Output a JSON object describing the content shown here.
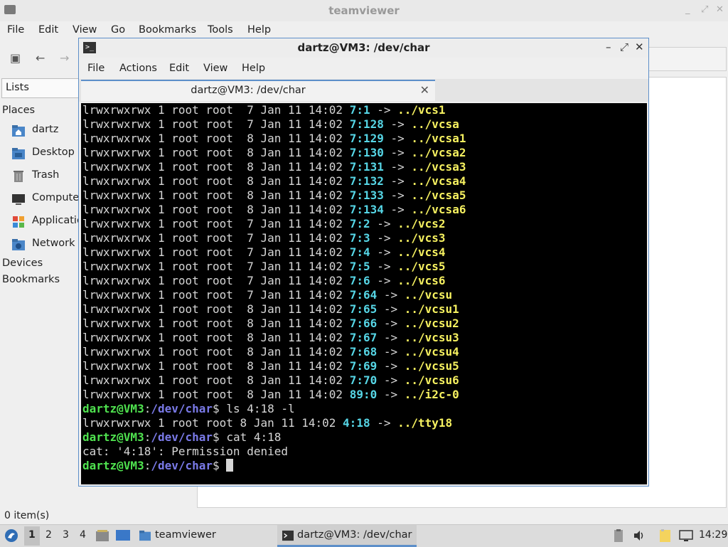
{
  "file_manager": {
    "window_title": "teamviewer",
    "menu": [
      "File",
      "Edit",
      "View",
      "Go",
      "Bookmarks",
      "Tools",
      "Help"
    ],
    "side_pane_selector": "Lists",
    "places_header": "Places",
    "places": [
      "dartz",
      "Desktop",
      "Trash",
      "Computer",
      "Applications",
      "Network"
    ],
    "devices_header": "Devices",
    "bookmarks_header": "Bookmarks",
    "status": "0 item(s)"
  },
  "terminal": {
    "window_title": "dartz@VM3: /dev/char",
    "menu": [
      "File",
      "Actions",
      "Edit",
      "View",
      "Help"
    ],
    "tab_title": "dartz@VM3: /dev/char",
    "lines": [
      [
        "lrwxrwxrwx 1 root root  7 Jan 11 14:02 ",
        "7:1",
        " -> ",
        "../vcs1"
      ],
      [
        "lrwxrwxrwx 1 root root  7 Jan 11 14:02 ",
        "7:128",
        " -> ",
        "../vcsa"
      ],
      [
        "lrwxrwxrwx 1 root root  8 Jan 11 14:02 ",
        "7:129",
        " -> ",
        "../vcsa1"
      ],
      [
        "lrwxrwxrwx 1 root root  8 Jan 11 14:02 ",
        "7:130",
        " -> ",
        "../vcsa2"
      ],
      [
        "lrwxrwxrwx 1 root root  8 Jan 11 14:02 ",
        "7:131",
        " -> ",
        "../vcsa3"
      ],
      [
        "lrwxrwxrwx 1 root root  8 Jan 11 14:02 ",
        "7:132",
        " -> ",
        "../vcsa4"
      ],
      [
        "lrwxrwxrwx 1 root root  8 Jan 11 14:02 ",
        "7:133",
        " -> ",
        "../vcsa5"
      ],
      [
        "lrwxrwxrwx 1 root root  8 Jan 11 14:02 ",
        "7:134",
        " -> ",
        "../vcsa6"
      ],
      [
        "lrwxrwxrwx 1 root root  7 Jan 11 14:02 ",
        "7:2",
        " -> ",
        "../vcs2"
      ],
      [
        "lrwxrwxrwx 1 root root  7 Jan 11 14:02 ",
        "7:3",
        " -> ",
        "../vcs3"
      ],
      [
        "lrwxrwxrwx 1 root root  7 Jan 11 14:02 ",
        "7:4",
        " -> ",
        "../vcs4"
      ],
      [
        "lrwxrwxrwx 1 root root  7 Jan 11 14:02 ",
        "7:5",
        " -> ",
        "../vcs5"
      ],
      [
        "lrwxrwxrwx 1 root root  7 Jan 11 14:02 ",
        "7:6",
        " -> ",
        "../vcs6"
      ],
      [
        "lrwxrwxrwx 1 root root  7 Jan 11 14:02 ",
        "7:64",
        " -> ",
        "../vcsu"
      ],
      [
        "lrwxrwxrwx 1 root root  8 Jan 11 14:02 ",
        "7:65",
        " -> ",
        "../vcsu1"
      ],
      [
        "lrwxrwxrwx 1 root root  8 Jan 11 14:02 ",
        "7:66",
        " -> ",
        "../vcsu2"
      ],
      [
        "lrwxrwxrwx 1 root root  8 Jan 11 14:02 ",
        "7:67",
        " -> ",
        "../vcsu3"
      ],
      [
        "lrwxrwxrwx 1 root root  8 Jan 11 14:02 ",
        "7:68",
        " -> ",
        "../vcsu4"
      ],
      [
        "lrwxrwxrwx 1 root root  8 Jan 11 14:02 ",
        "7:69",
        " -> ",
        "../vcsu5"
      ],
      [
        "lrwxrwxrwx 1 root root  8 Jan 11 14:02 ",
        "7:70",
        " -> ",
        "../vcsu6"
      ],
      [
        "lrwxrwxrwx 1 root root  8 Jan 11 14:02 ",
        "89:0",
        " -> ",
        "../i2c-0"
      ]
    ],
    "prompt_user": "dartz@VM3",
    "prompt_path": "/dev/char",
    "cmd1": " ls 4:18 -l",
    "ls_result": [
      "lrwxrwxrwx 1 root root 8 Jan 11 14:02 ",
      "4:18",
      " -> ",
      "../tty18"
    ],
    "cmd2": " cat 4:18",
    "error": "cat: '4:18': Permission denied"
  },
  "panel": {
    "workspaces": [
      "1",
      "2",
      "3",
      "4"
    ],
    "tasks": [
      "teamviewer",
      "dartz@VM3: /dev/char"
    ],
    "clock": "14:29"
  },
  "colors": {
    "terminal_bg": "#000000",
    "device_number": "#56d6e6",
    "link_target": "#f6f160",
    "prompt_user": "#4fe24f",
    "prompt_path": "#7a7ae8",
    "accent": "#5d8fc9"
  }
}
